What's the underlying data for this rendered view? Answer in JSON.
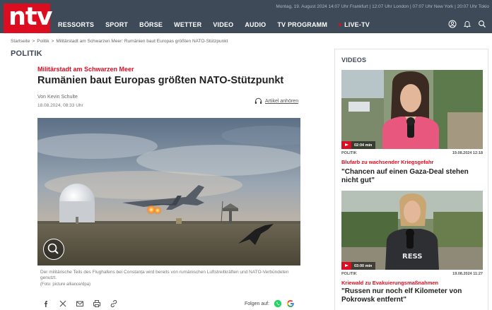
{
  "header": {
    "logo": "ntv",
    "topline": "Montag, 19. August 2024 14:07 Uhr Frankfurt | 12:07 Uhr London | 07:07 Uhr New York | 20:07 Uhr Tokio",
    "nav": [
      "RESSORTS",
      "SPORT",
      "BÖRSE",
      "WETTER",
      "VIDEO",
      "AUDIO",
      "TV PROGRAMM",
      "LIVE-TV"
    ],
    "icons": [
      "user-icon",
      "bell-icon",
      "search-icon"
    ]
  },
  "breadcrumb": {
    "items": [
      "Startseite",
      "Politik",
      "Militärstadt am Schwarzen Meer: Rumänien baut Europas größten NATO-Stützpunkt"
    ],
    "separator": ">"
  },
  "section_title": "POLITIK",
  "article": {
    "kicker": "Militärstadt am Schwarzen Meer",
    "headline": "Rumänien baut Europas größten NATO-Stützpunkt",
    "author_prefix": "Von",
    "author": "Kevin Schulte",
    "date": "18.08.2024, 08:33 Uhr",
    "listen_label": "Artikel anhören",
    "caption": "Der militärische Teils des Flughafens bei Constanța wird bereits von rumänischen Luftstreitkräften und NATO-Verbündeten genutzt.",
    "credit": "(Foto: picture alliance/dpa)",
    "share_icons": [
      "facebook-icon",
      "x-icon",
      "mail-icon",
      "print-icon",
      "link-icon"
    ],
    "follow_label": "Folgen auf:",
    "follow_icons": [
      "whatsapp-icon",
      "google-icon"
    ]
  },
  "sidebar": {
    "title": "VIDEOS",
    "videos": [
      {
        "duration": "02:04 min",
        "category": "POLITIK",
        "date": "19.08.2024 12:18",
        "kicker": "Blufarb zu wachsender Kriegsgefahr",
        "title": "\"Chancen auf einen Gaza-Deal stehen nicht gut\""
      },
      {
        "duration": "03:00 min",
        "category": "POLITIK",
        "date": "19.08.2024 11:27",
        "kicker": "Kriewald zu Evakuierungsmaßnahmen",
        "title": "\"Russen nur noch elf Kilometer von Pokrowsk entfernt\""
      }
    ]
  },
  "colors": {
    "brand_red": "#dd0d21",
    "header_bg": "#3e4a57",
    "whatsapp_green": "#25d366"
  }
}
